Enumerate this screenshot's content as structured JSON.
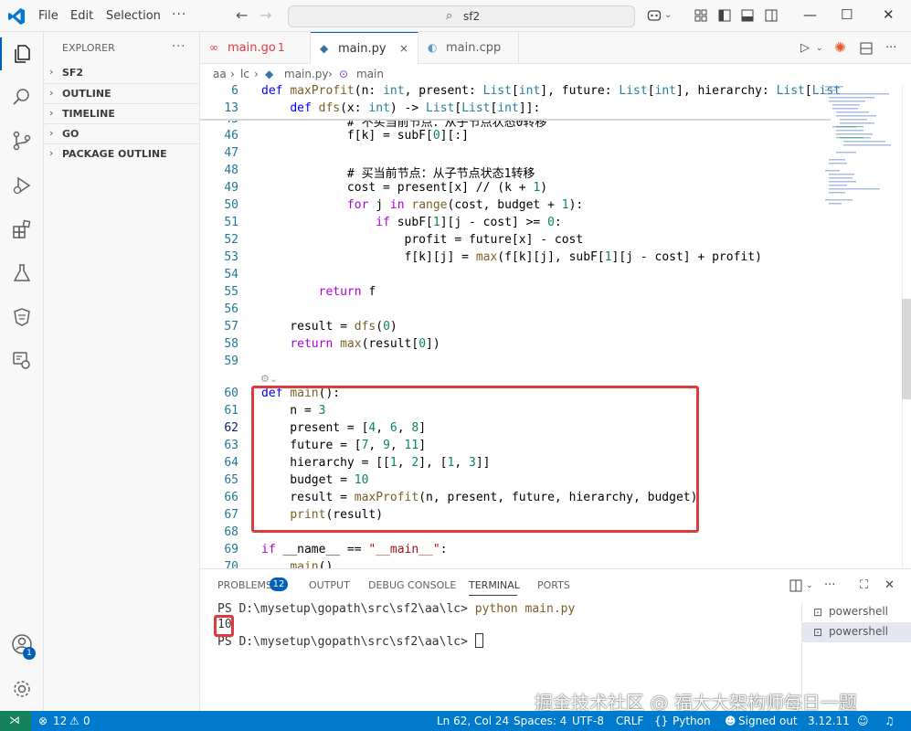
{
  "titlebar": {
    "menu": [
      {
        "label": "File"
      },
      {
        "label": "Edit"
      },
      {
        "label": "Selection"
      }
    ],
    "more": "···",
    "search_text": "sf2"
  },
  "sidebar": {
    "header": "EXPLORER",
    "more": "···",
    "sections": [
      "SF2",
      "OUTLINE",
      "TIMELINE",
      "GO",
      "PACKAGE OUTLINE"
    ]
  },
  "tabs": [
    {
      "name": "main.go",
      "extra": "1",
      "icon_color": "#e03a3e"
    },
    {
      "name": "main.py",
      "extra": "×",
      "icon_color": "#3572a5"
    },
    {
      "name": "main.cpp",
      "extra": "",
      "icon_color": "#6295cb"
    }
  ],
  "breadcrumb": [
    "aa",
    "lc",
    "main.py",
    "main"
  ],
  "editor": {
    "sticky": [
      {
        "ln": "6",
        "code": "def maxProfit(n: int, present: List[int], future: List[int], hierarchy: List[List"
      },
      {
        "ln": "13",
        "code": "    def dfs(x: int) -> List[List[int]]:"
      }
    ],
    "lines": [
      {
        "ln": "43",
        "code": "            # 不买当前节点：从子节点状态0转移"
      },
      {
        "ln": "46",
        "code": "            f[k] = subF[0][:]"
      },
      {
        "ln": "47",
        "code": ""
      },
      {
        "ln": "48",
        "code": "            # 买当前节点：从子节点状态1转移"
      },
      {
        "ln": "49",
        "code": "            cost = present[x] // (k + 1)"
      },
      {
        "ln": "50",
        "code": "            for j in range(cost, budget + 1):"
      },
      {
        "ln": "51",
        "code": "                if subF[1][j - cost] >= 0:"
      },
      {
        "ln": "52",
        "code": "                    profit = future[x] - cost"
      },
      {
        "ln": "53",
        "code": "                    f[k][j] = max(f[k][j], subF[1][j - cost] + profit)"
      },
      {
        "ln": "54",
        "code": ""
      },
      {
        "ln": "55",
        "code": "        return f"
      },
      {
        "ln": "56",
        "code": ""
      },
      {
        "ln": "57",
        "code": "    result = dfs(0)"
      },
      {
        "ln": "58",
        "code": "    return max(result[0])"
      },
      {
        "ln": "59",
        "code": ""
      },
      {
        "ln": "60",
        "code": "def main():"
      },
      {
        "ln": "61",
        "code": "    n = 3"
      },
      {
        "ln": "62",
        "code": "    present = [4, 6, 8]"
      },
      {
        "ln": "63",
        "code": "    future = [7, 9, 11]"
      },
      {
        "ln": "64",
        "code": "    hierarchy = [[1, 2], [1, 3]]"
      },
      {
        "ln": "65",
        "code": "    budget = 10"
      },
      {
        "ln": "66",
        "code": "    result = maxProfit(n, present, future, hierarchy, budget)"
      },
      {
        "ln": "67",
        "code": "    print(result)"
      },
      {
        "ln": "68",
        "code": ""
      },
      {
        "ln": "69",
        "code": "if __name__ == \"__main__\":"
      },
      {
        "ln": "70",
        "code": "    main()"
      }
    ]
  },
  "panel": {
    "tabs": [
      "PROBLEMS",
      "OUTPUT",
      "DEBUG CONSOLE",
      "TERMINAL",
      "PORTS"
    ],
    "problems_count": "12",
    "terminal": {
      "prompt1": "PS D:\\mysetup\\gopath\\src\\sf2\\aa\\lc> ",
      "cmd": "python main.py",
      "output": "10",
      "prompt2": "PS D:\\mysetup\\gopath\\src\\sf2\\aa\\lc> "
    },
    "terminals": [
      "powershell",
      "powershell"
    ]
  },
  "watermark": "掘金技术社区 @ 福大大架构师每日一题",
  "status": {
    "errors": "12",
    "warnings": "0",
    "position": "Ln 62, Col 24",
    "spaces": "Spaces: 4",
    "encoding": "UTF-8",
    "eol": "CRLF",
    "language": "Python",
    "account": "Signed out",
    "version": "3.12.11"
  },
  "colors": {
    "accent": "#005fb8",
    "statusbar": "#007acc",
    "highlight": "#e03a3e"
  }
}
